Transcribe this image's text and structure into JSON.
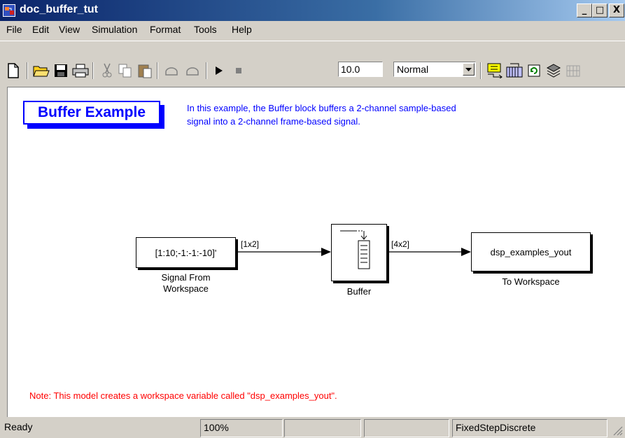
{
  "window": {
    "title": "doc_buffer_tut",
    "controls": {
      "minimize": "_",
      "maximize": "□",
      "close": "X"
    }
  },
  "menu": {
    "items": [
      {
        "label": "File"
      },
      {
        "label": "Edit"
      },
      {
        "label": "View"
      },
      {
        "label": "Simulation"
      },
      {
        "label": "Format"
      },
      {
        "label": "Tools"
      },
      {
        "label": "Help"
      }
    ]
  },
  "toolbar": {
    "tools": [
      {
        "name": "new-model",
        "icon": "new-file-icon"
      },
      {
        "name": "open",
        "icon": "open-folder-icon"
      },
      {
        "name": "save",
        "icon": "save-disk-icon"
      },
      {
        "name": "print",
        "icon": "printer-icon"
      },
      {
        "name": "cut",
        "icon": "scissors-icon"
      },
      {
        "name": "copy",
        "icon": "copy-icon"
      },
      {
        "name": "paste",
        "icon": "paste-icon"
      },
      {
        "name": "undo",
        "icon": "undo-icon"
      },
      {
        "name": "redo",
        "icon": "redo-icon"
      },
      {
        "name": "start",
        "icon": "play-icon"
      },
      {
        "name": "stop",
        "icon": "stop-icon"
      },
      {
        "name": "build",
        "icon": "build-icon"
      },
      {
        "name": "library",
        "icon": "library-icon"
      },
      {
        "name": "update",
        "icon": "refresh-icon"
      },
      {
        "name": "explorer",
        "icon": "explorer-icon"
      },
      {
        "name": "debug",
        "icon": "debug-icon"
      }
    ],
    "stop_time": "10.0",
    "sim_mode": "Normal"
  },
  "canvas": {
    "title": "Buffer Example",
    "description_line1": "In this example, the Buffer block buffers a 2-channel sample-based",
    "description_line2": "signal into a 2-channel frame-based signal.",
    "blocks": {
      "source": {
        "text": "[1:10;-1:-1:-10]'",
        "label_line1": "Signal From",
        "label_line2": "Workspace"
      },
      "buffer": {
        "label": "Buffer"
      },
      "sink": {
        "text": "dsp_examples_yout",
        "label": "To Workspace"
      }
    },
    "signals": {
      "in_dim": "[1x2]",
      "out_dim": "[4x2]"
    },
    "note": "Note: This model creates a workspace variable called \"dsp_examples_yout\"."
  },
  "status": {
    "state": "Ready",
    "zoom": "100%",
    "solver": "FixedStepDiscrete"
  },
  "colors": {
    "title_bar_start": "#0a246a",
    "annotation_blue": "#0000ff",
    "note_red": "#ff0000",
    "chrome": "#d4d0c8"
  }
}
